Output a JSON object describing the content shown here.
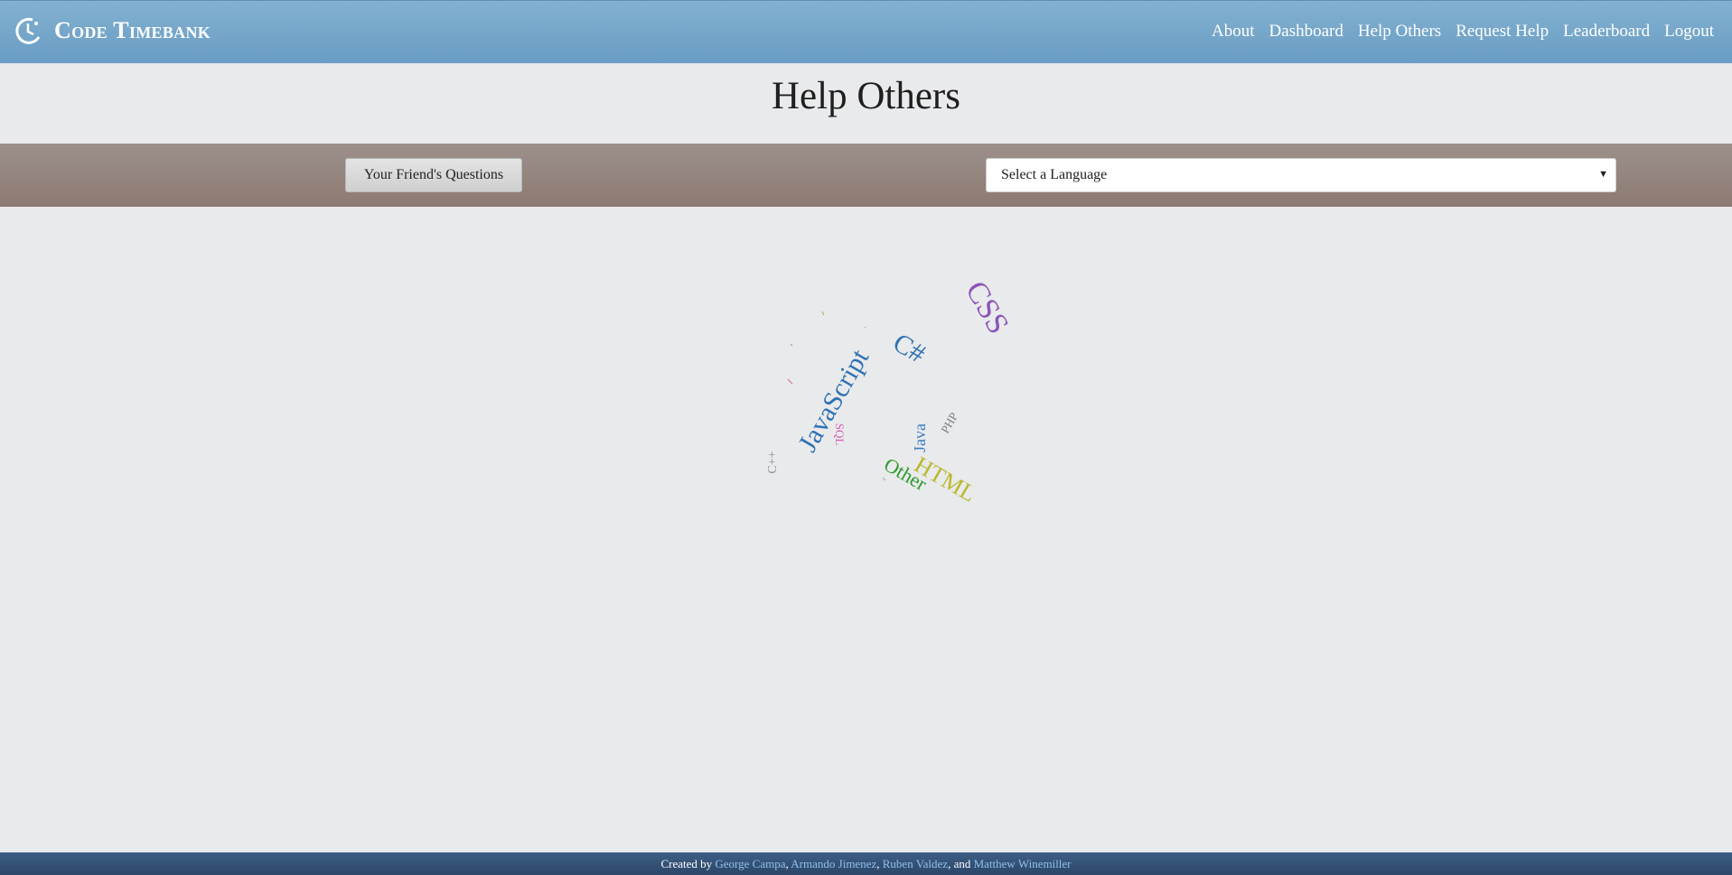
{
  "brand": {
    "name": "Code Timebank"
  },
  "nav": {
    "about": "About",
    "dashboard": "Dashboard",
    "help_others": "Help Others",
    "request_help": "Request Help",
    "leaderboard": "Leaderboard",
    "logout": "Logout"
  },
  "page": {
    "title": "Help Others"
  },
  "filters": {
    "friends_button": "Your Friend's Questions",
    "language_select": "Select a Language"
  },
  "word_cloud": {
    "words": [
      "CSS",
      "C#",
      "JavaScript",
      "SQL",
      "Java",
      "PHP",
      "C++",
      "Other",
      "HTML"
    ]
  },
  "footer": {
    "prefix": "Created by",
    "authors": [
      "George Campa",
      "Armando Jimenez",
      "Ruben Valdez",
      "Matthew Winemiller"
    ],
    "sep1": ",",
    "sep2": ",",
    "sep3": ", and"
  },
  "colors": {
    "navbar": "#6fa3c8",
    "filter_bar": "#948580",
    "footer": "#34506f",
    "css": "#8a55b8",
    "csharp": "#2f72b3",
    "javascript": "#2f72b3",
    "sql": "#d95bb0",
    "java": "#3a7cc0",
    "php": "#7e7e7e",
    "cpp": "#8a8a8a",
    "other": "#2f9a2a",
    "html": "#b8b82c"
  }
}
